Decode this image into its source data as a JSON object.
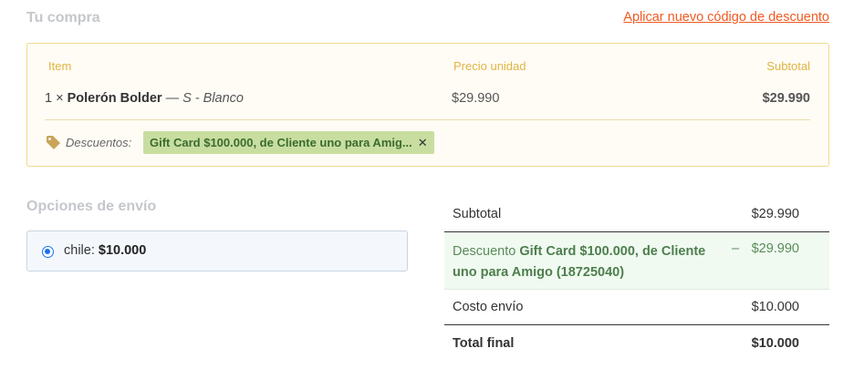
{
  "header": {
    "title": "Tu compra",
    "discount_link": "Aplicar nuevo código de descuento"
  },
  "cart": {
    "columns": {
      "item": "Item",
      "unit_price": "Precio unidad",
      "subtotal": "Subtotal"
    },
    "items": [
      {
        "qty": "1 ×",
        "name": "Polerón Bolder",
        "variant": "— S - Blanco",
        "unit_price": "$29.990",
        "subtotal": "$29.990"
      }
    ],
    "discounts_label": "Descuentos:",
    "discount_pill": "Gift Card $100.000, de Cliente uno para Amig...",
    "remove_symbol": "✕"
  },
  "shipping": {
    "title": "Opciones de envío",
    "option_name": "chile:",
    "option_price": "$10.000",
    "selected": true
  },
  "totals": {
    "subtotal_label": "Subtotal",
    "subtotal_value": "$29.990",
    "discount_prefix": "Descuento",
    "discount_name": "Gift Card $100.000, de Cliente uno para Amigo (18725040)",
    "discount_sign": "–",
    "discount_value": "$29.990",
    "shipping_label": "Costo envío",
    "shipping_value": "$10.000",
    "total_label": "Total final",
    "total_value": "$10.000"
  },
  "colors": {
    "link": "#f05a22",
    "cart_border": "#f1d98c",
    "discount_pill_bg": "#c8dea0",
    "radio": "#1a73e8"
  }
}
